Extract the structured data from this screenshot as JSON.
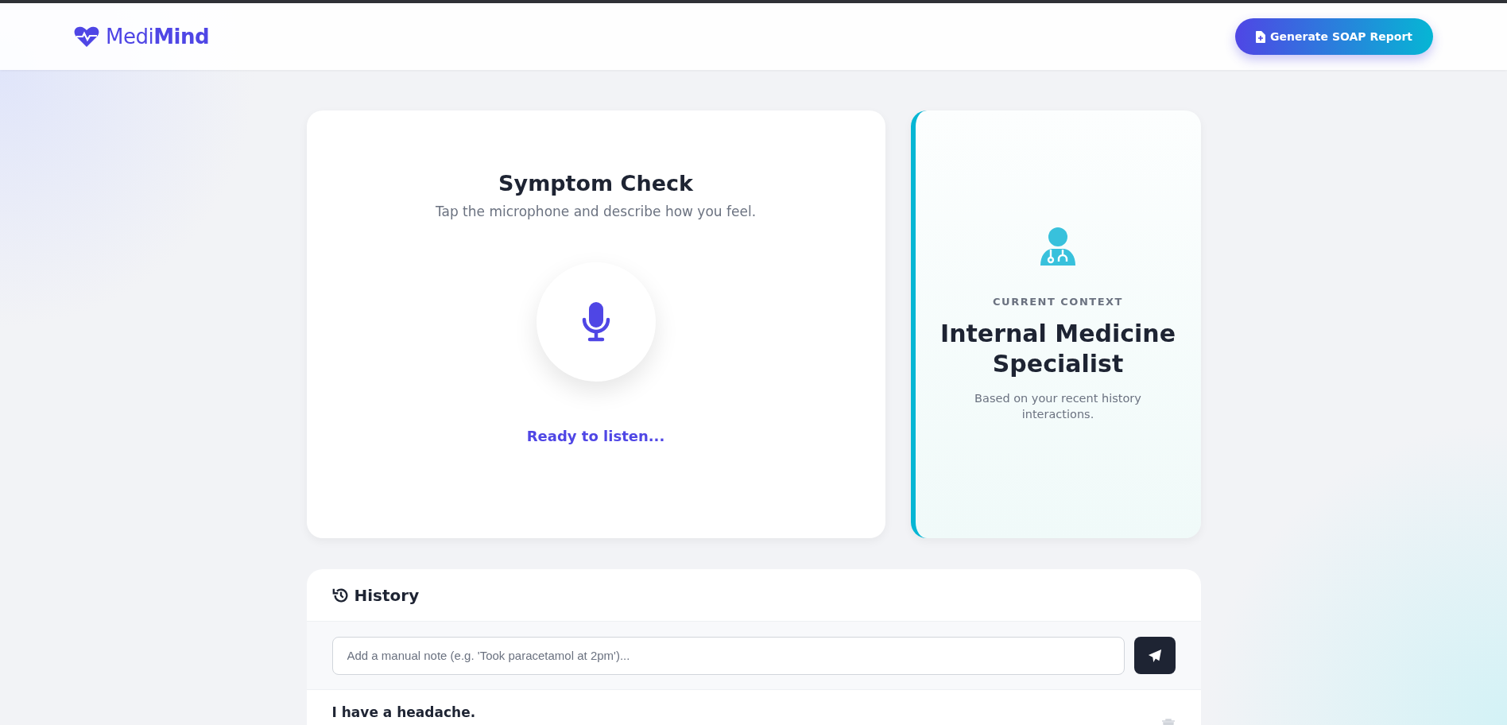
{
  "header": {
    "logo": {
      "light": "Medi",
      "bold": "Mind"
    },
    "action_button": "Generate SOAP Report"
  },
  "symptom_check": {
    "title": "Symptom Check",
    "subtitle": "Tap the microphone and describe how you feel.",
    "status": "Ready to listen..."
  },
  "context": {
    "eyebrow": "CURRENT CONTEXT",
    "title": "Internal Medicine Specialist",
    "note": "Based on your recent history interactions."
  },
  "history": {
    "title": "History",
    "note_field": {
      "placeholder": "Add a manual note (e.g. 'Took paracetamol at 2pm')..."
    },
    "entries": [
      {
        "text": "I have a headache."
      }
    ]
  }
}
